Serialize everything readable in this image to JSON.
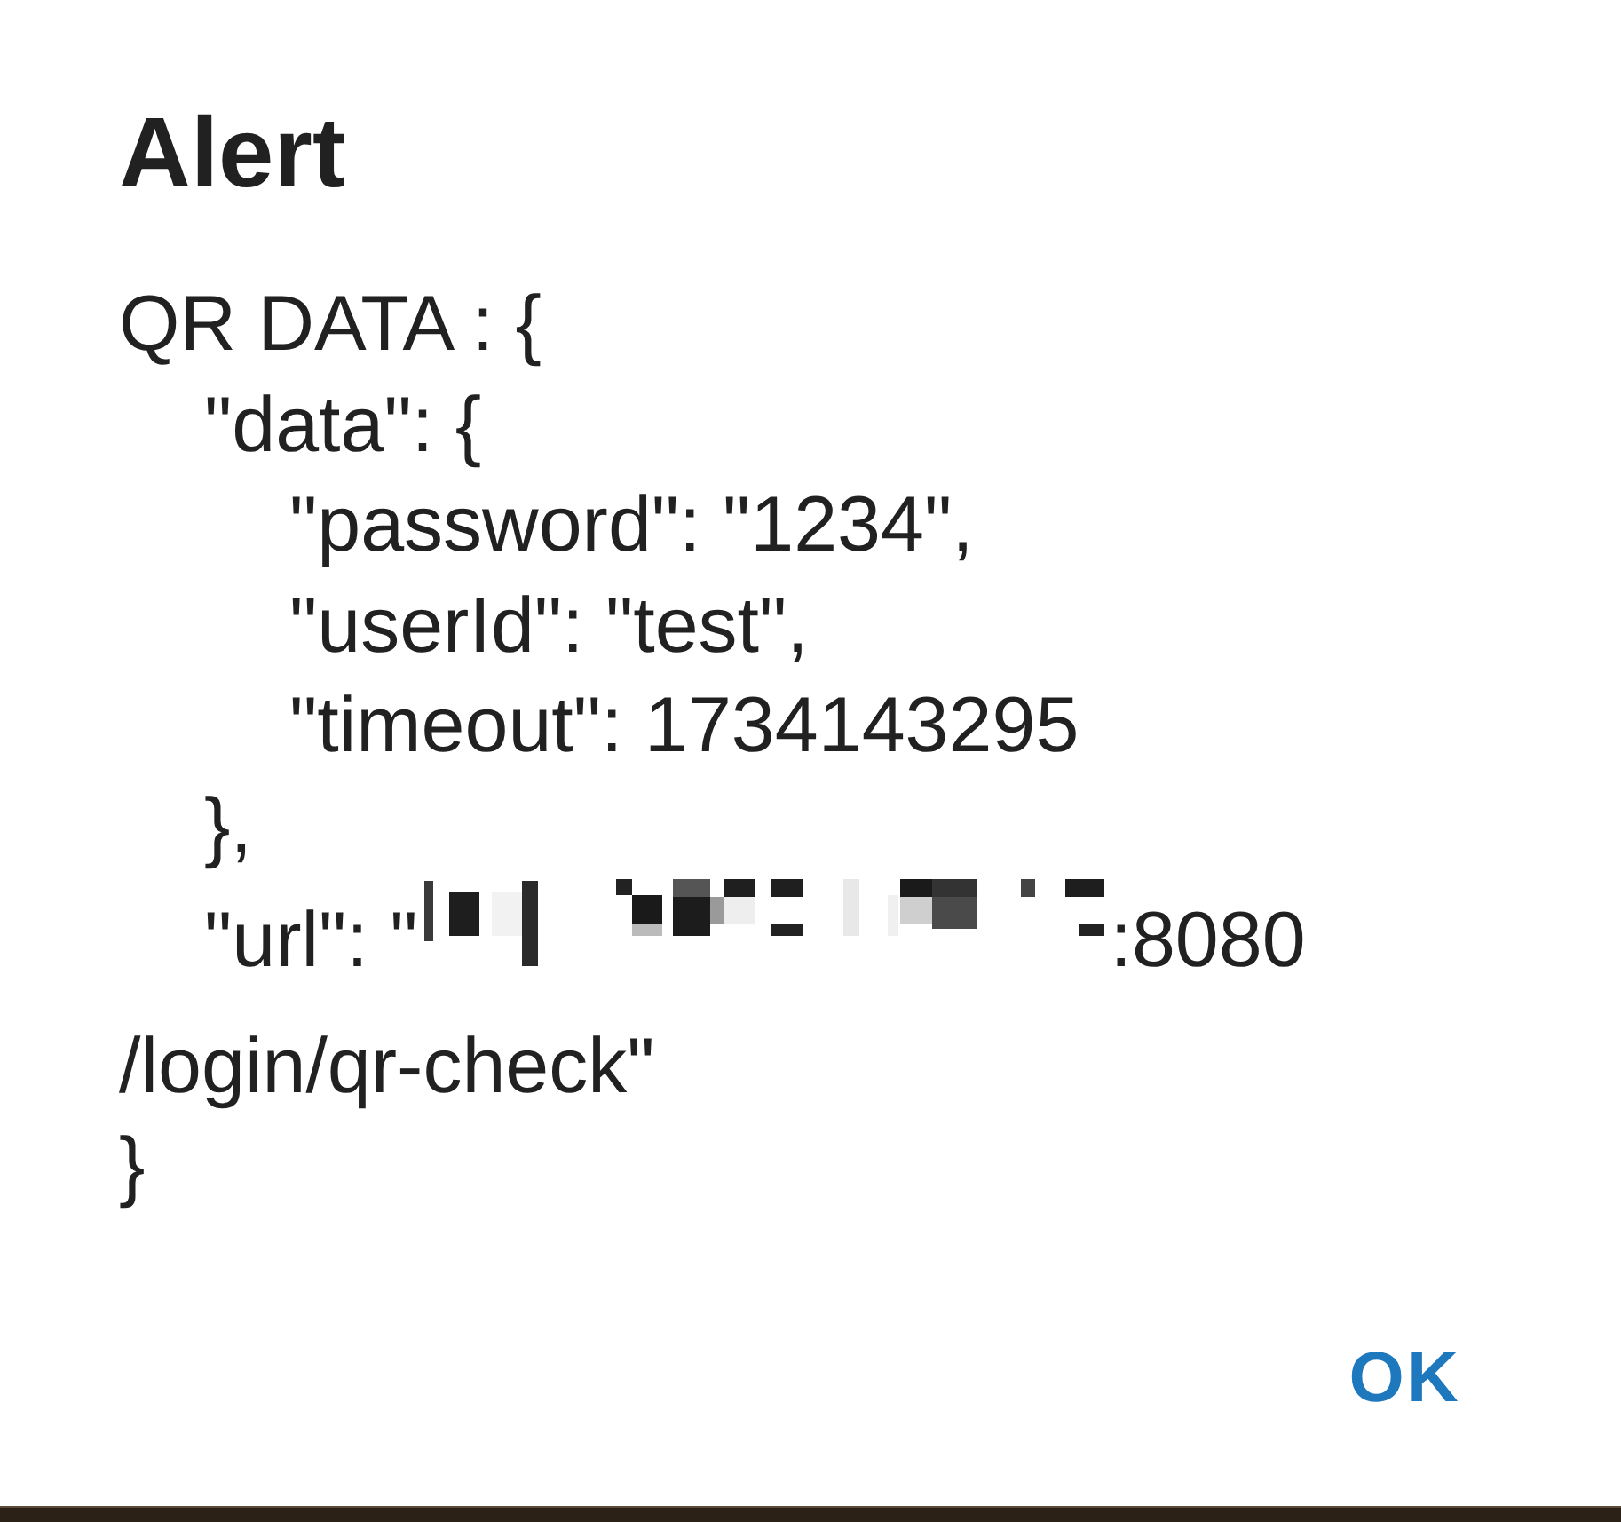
{
  "dialog": {
    "title": "Alert",
    "message": {
      "lines": [
        {
          "kind": "text",
          "text": "QR DATA : {",
          "children": [
            {
              "kind": "text",
              "text": "\"data\": {",
              "children": [
                {
                  "kind": "text",
                  "text": "\"password\": \"1234\","
                },
                {
                  "kind": "text",
                  "text": "\"userId\": \"test\","
                },
                {
                  "kind": "text",
                  "text": "\"timeout\": 1734143295"
                }
              ]
            },
            {
              "kind": "text",
              "text": "},"
            },
            {
              "kind": "masked",
              "before": "\"url\": \"",
              "redacted": true,
              "after": ":8080"
            }
          ]
        },
        {
          "kind": "text",
          "text": "/login/qr-check\""
        },
        {
          "kind": "text",
          "text": "}"
        }
      ]
    },
    "buttons": [
      {
        "label": "OK"
      }
    ]
  }
}
